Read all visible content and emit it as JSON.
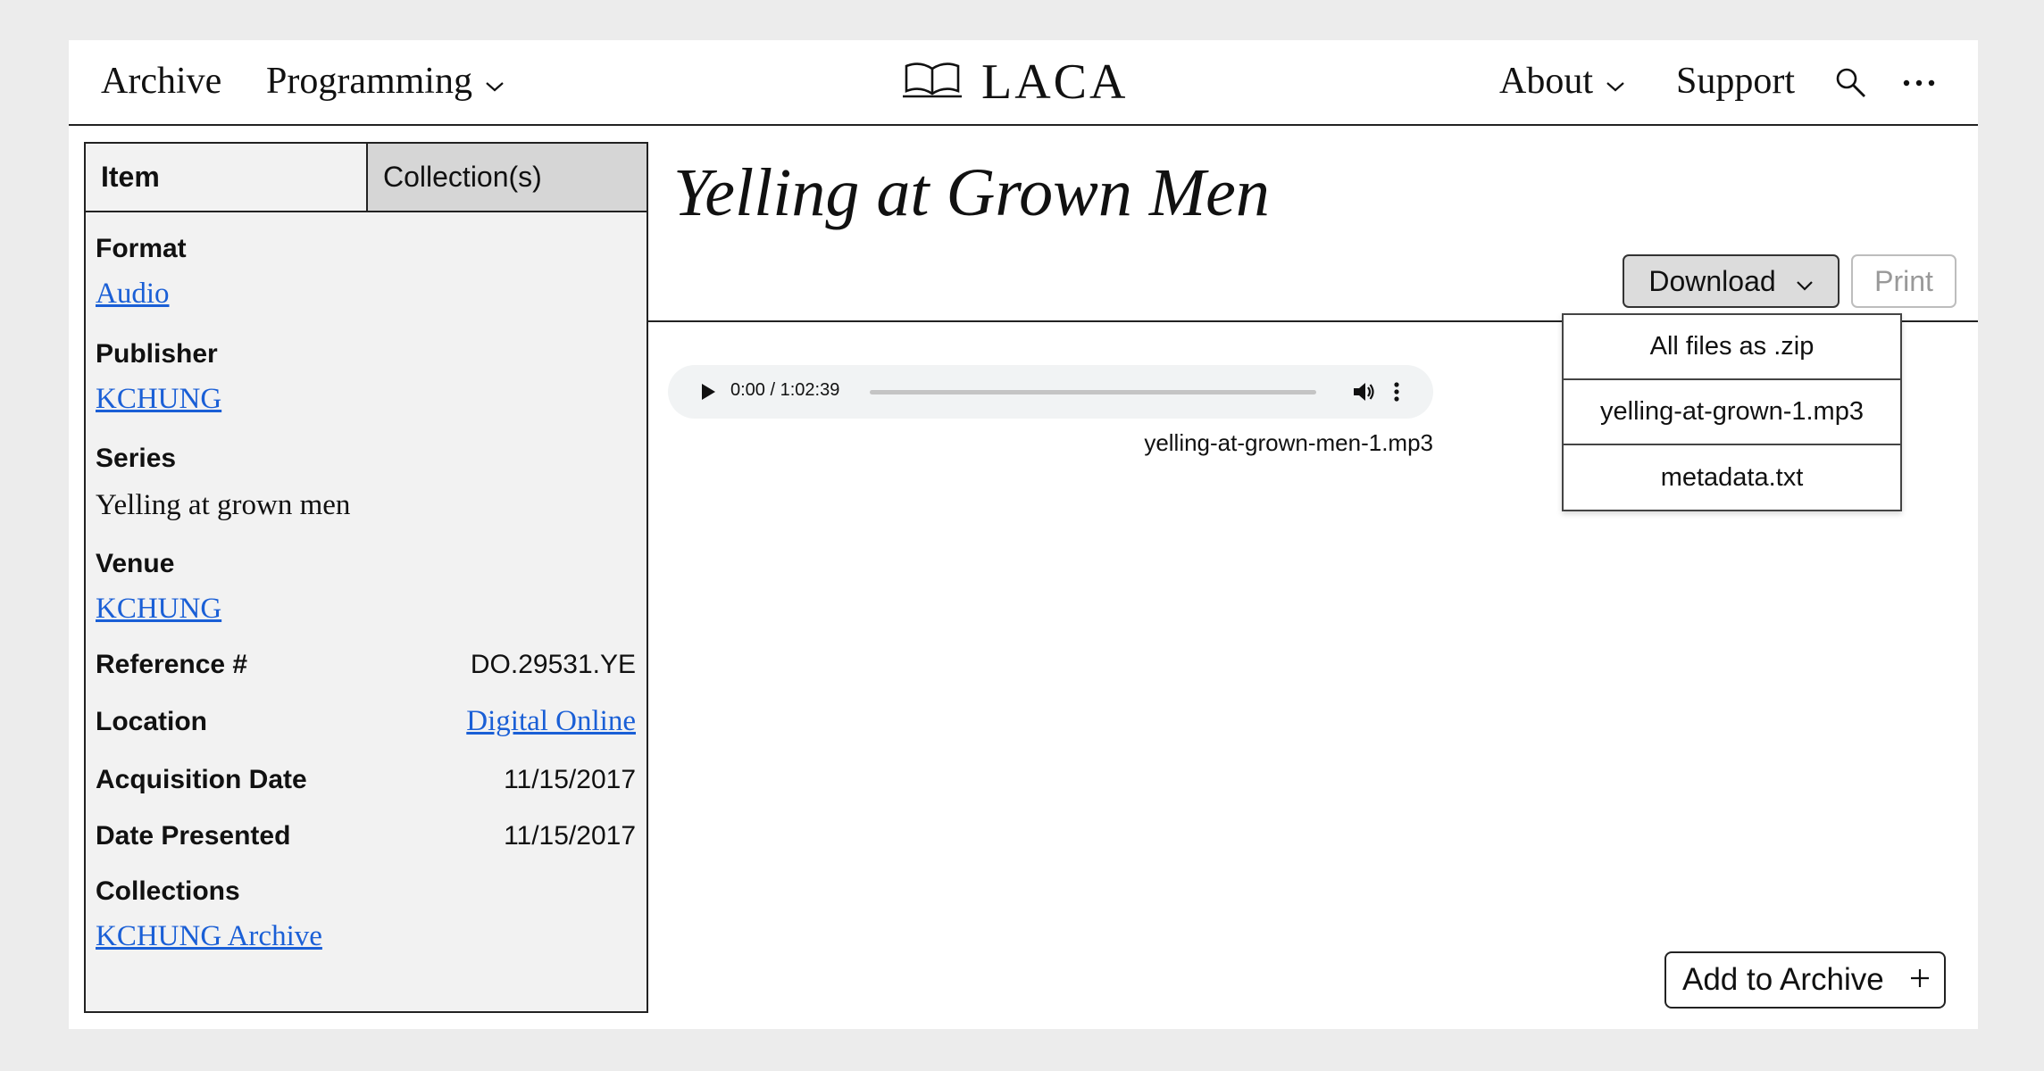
{
  "nav": {
    "archive": "Archive",
    "programming": "Programming",
    "brand": "LACA",
    "about": "About",
    "support": "Support"
  },
  "sidebar": {
    "tabs": [
      "Item",
      "Collection(s)"
    ],
    "format": {
      "label": "Format",
      "value": "Audio"
    },
    "publisher": {
      "label": "Publisher",
      "value": "KCHUNG"
    },
    "series": {
      "label": "Series",
      "value": "Yelling at grown men"
    },
    "venue": {
      "label": "Venue",
      "value": "KCHUNG"
    },
    "reference": {
      "label": "Reference #",
      "value": "DO.29531.YE"
    },
    "location": {
      "label": "Location",
      "value": "Digital Online"
    },
    "acquisition": {
      "label": "Acquisition Date",
      "value": "11/15/2017"
    },
    "presented": {
      "label": "Date Presented",
      "value": "11/15/2017"
    },
    "collections": {
      "label": "Collections",
      "value": "KCHUNG Archive"
    }
  },
  "main": {
    "title": "Yelling at Grown Men",
    "download_label": "Download",
    "print_label": "Print",
    "download_menu": [
      "All files as .zip",
      "yelling-at-grown-1.mp3",
      "metadata.txt"
    ],
    "player": {
      "time": "0:00 / 1:02:39",
      "progress": 0
    },
    "filename": "yelling-at-grown-men-1.mp3",
    "add_label": "Add to Archive"
  },
  "colors": {
    "link": "#1a5fd6",
    "page_bg": "#ececec",
    "sidebar_bg": "#f2f2f2"
  }
}
